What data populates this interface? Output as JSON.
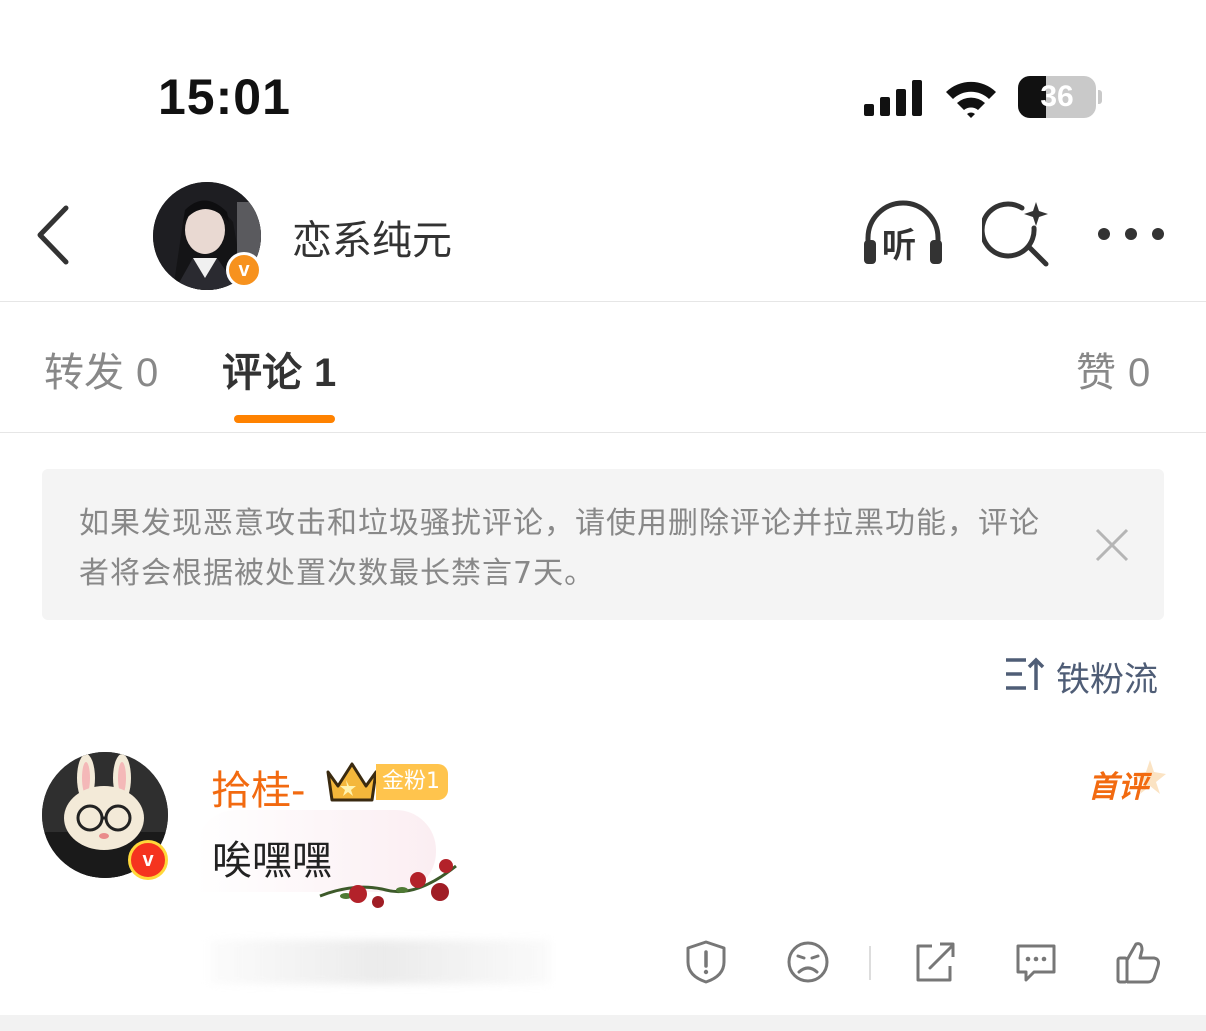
{
  "status_bar": {
    "time": "15:01",
    "battery_level": "36",
    "battery_fraction": 0.36
  },
  "nav": {
    "title": "恋系纯元",
    "listen_icon_label": "听"
  },
  "tabs": [
    {
      "label": "转发",
      "count": "0"
    },
    {
      "label": "评论",
      "count": "1"
    },
    {
      "label": "赞",
      "count": "0"
    }
  ],
  "notice": {
    "text": "如果发现恶意攻击和垃圾骚扰评论，请使用删除评论并拉黑功能，评论者将会根据被处置次数最长禁言7天。"
  },
  "sort": {
    "label": "铁粉流"
  },
  "comment": {
    "username": "拾桂-",
    "fan_badge": "金粉1",
    "first_comment_label": "首评",
    "text": "唉嘿嘿"
  },
  "colors": {
    "accent": "#ff8200",
    "username": "#f26a10",
    "sort_label": "#4f5d76",
    "verified_badge": "#f7921e"
  },
  "icons": {
    "back": "chevron-left-icon",
    "listen": "headphones-icon",
    "search": "ai-search-icon",
    "more": "more-dots-icon",
    "close": "close-icon",
    "sort": "sort-icon",
    "report": "report-shield-icon",
    "dislike": "sad-face-icon",
    "share": "share-icon",
    "reply": "reply-bubble-icon",
    "like": "thumbs-up-icon"
  }
}
